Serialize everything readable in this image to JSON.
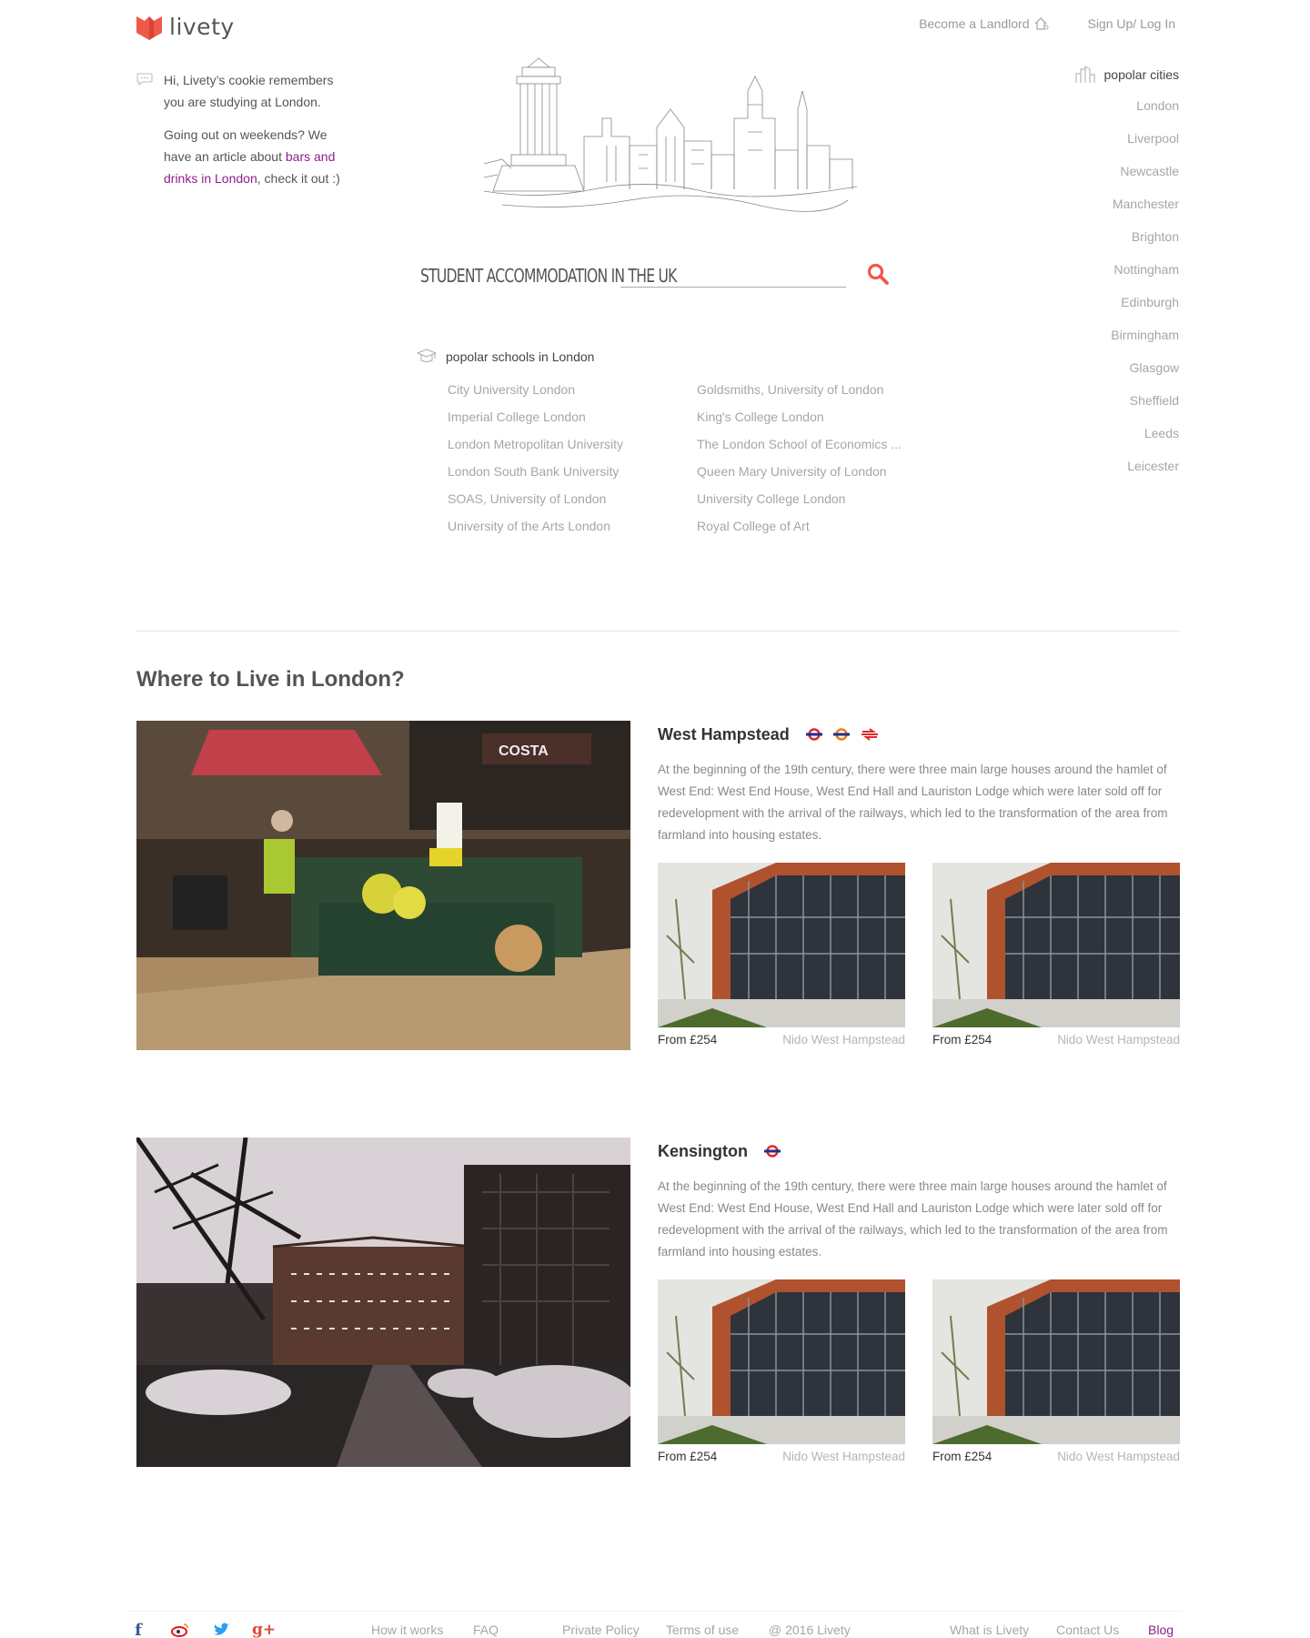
{
  "brand": {
    "name": "livety",
    "color": "#f0584a"
  },
  "top_nav": {
    "become_landlord": "Become a Landlord",
    "signup_login": "Sign Up/ Log In"
  },
  "cookie": {
    "line1": "Hi, Livety’s cookie remembers you are studying at London.",
    "line2_pre": "Going out on weekends? We have an article about ",
    "line2_link": "bars and drinks in London",
    "line2_post": ", check it out :)"
  },
  "search": {
    "title": "Student Accommodation in the UK",
    "placeholder": "",
    "icon": "search-icon"
  },
  "schools": {
    "heading": "popolar schools in London",
    "items": [
      "City University London",
      "Goldsmiths, University of London",
      "Imperial College London",
      "King's College London",
      "London Metropolitan University",
      "The London School of Economics ...",
      "London South Bank University",
      "Queen Mary University of London",
      "SOAS, University of London",
      "University College London",
      "University of the Arts London",
      "Royal College of Art"
    ]
  },
  "cities": {
    "heading": "popolar cities",
    "items": [
      "London",
      "Liverpool",
      "Newcastle",
      "Manchester",
      "Brighton",
      "Nottingham",
      "Edinburgh",
      "Birmingham",
      "Glasgow",
      "Sheffield",
      "Leeds",
      "Leicester"
    ]
  },
  "areas_title": "Where to Live in London?",
  "areas": [
    {
      "name": "West Hampstead",
      "transport": [
        "underground",
        "overground",
        "national-rail"
      ],
      "description": "At the beginning of the 19th century, there were three main large houses around the hamlet of West End: West End House, West End Hall and Lauriston Lodge which were later sold off for redevelopment with the arrival of the railways, which led to the transformation of the area from farmland into housing estates.",
      "listings": [
        {
          "price": "From £254",
          "name": "Nido West Hampstead"
        },
        {
          "price": "From £254",
          "name": "Nido West Hampstead"
        }
      ]
    },
    {
      "name": "Kensington",
      "transport": [
        "underground"
      ],
      "description": "At the beginning of the 19th century, there were three main large houses around the hamlet of West End: West End House, West End Hall and Lauriston Lodge which were later sold off for redevelopment with the arrival of the railways, which led to the transformation of the area from farmland into housing estates.",
      "listings": [
        {
          "price": "From £254",
          "name": "Nido West Hampstead"
        },
        {
          "price": "From £254",
          "name": "Nido West Hampstead"
        }
      ]
    }
  ],
  "footer": {
    "links": [
      "How it works",
      "FAQ",
      "Private Policy",
      "Terms of use",
      "@ 2016 Livety",
      "What is Livety",
      "Contact Us",
      "Blog"
    ],
    "social": [
      "facebook-icon",
      "weibo-icon",
      "twitter-icon",
      "google-plus-icon"
    ]
  },
  "colors": {
    "accent_purple": "#8e1f8d",
    "search_red": "#f0584a",
    "tfl_blue": "#1c2f8c",
    "tfl_red": "#e3262d"
  }
}
